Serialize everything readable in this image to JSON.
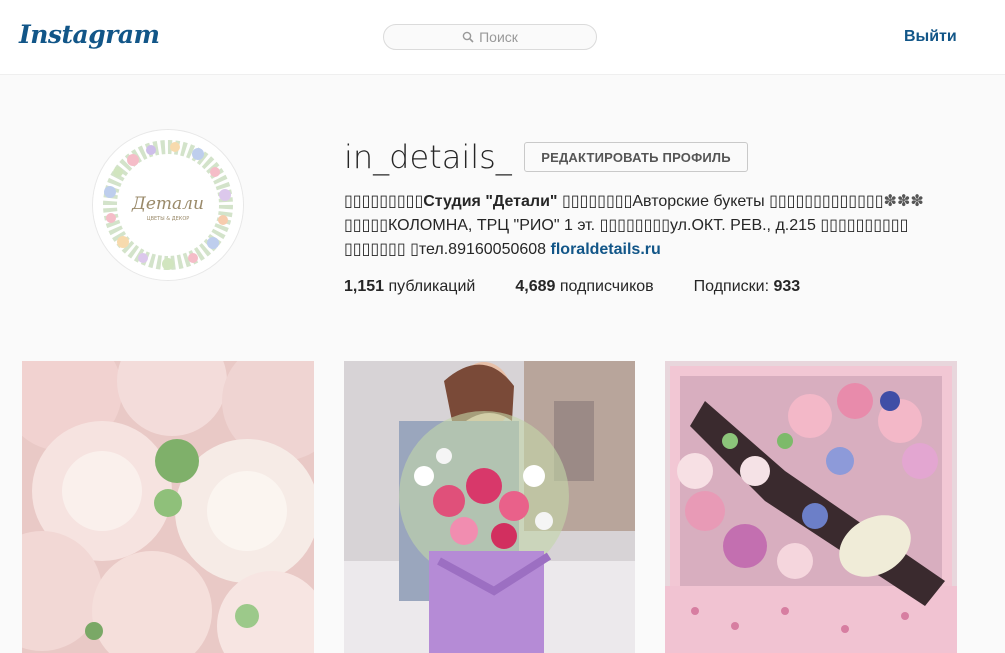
{
  "header": {
    "logo": "Instagram",
    "search_placeholder": "Поиск",
    "logout": "Выйти"
  },
  "profile": {
    "username": "in_details_",
    "edit_button": "РЕДАКТИРОВАТЬ ПРОФИЛЬ",
    "avatar_text": "Детали",
    "avatar_subtext": "ЦВЕТЫ & ДЕКОР",
    "bio": {
      "line1_prefix": "▯▯▯▯▯▯▯▯▯",
      "line1_name": "Студия \"Детали\"",
      "line1_mid": " ▯▯▯▯▯▯▯▯Авторские букеты ▯▯▯▯▯▯▯▯▯▯▯▯▯",
      "line1_flowers": "✽✽✽",
      "line2": "▯▯▯▯▯КОЛОМНА, ТРЦ \"РИО\" 1 эт. ▯▯▯▯▯▯▯▯ул.ОКТ. РЕВ., д.215 ▯▯▯▯▯▯▯▯▯▯",
      "line3": "▯▯▯▯▯▯▯ ▯тел.89160050608 ",
      "link": "floraldetails.ru"
    },
    "stats": {
      "posts_count": "1,151",
      "posts_label": " публикаций",
      "followers_count": "4,689",
      "followers_label": " подписчиков",
      "following_label": "Подписки: ",
      "following_count": "933"
    }
  },
  "colors": {
    "brand": "#125688",
    "background": "#fafafa"
  }
}
